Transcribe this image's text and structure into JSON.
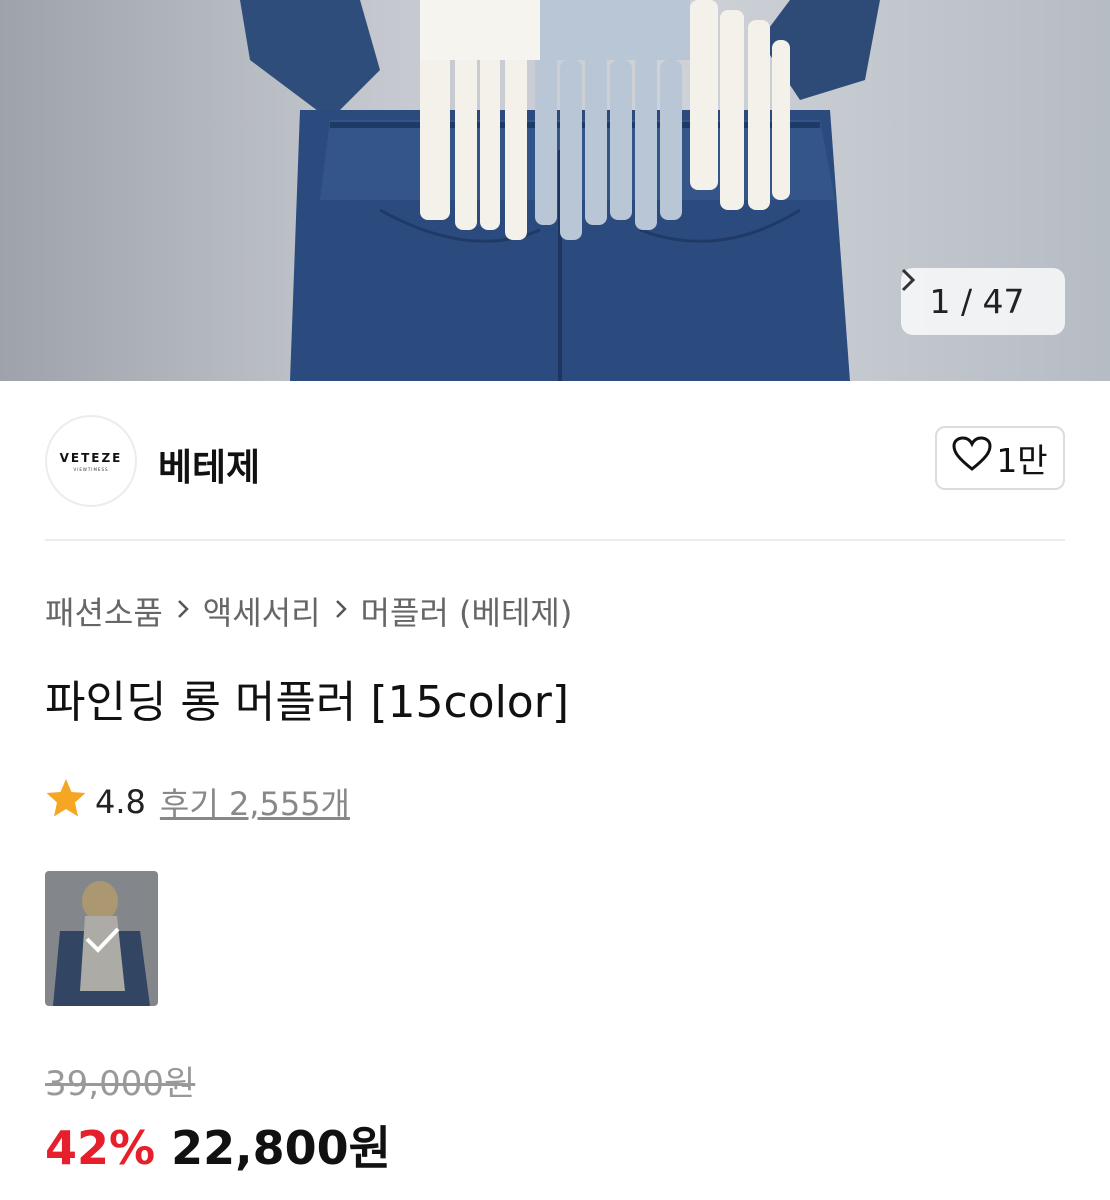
{
  "gallery": {
    "counter": "1 / 47",
    "next_icon": "chevron-right-icon"
  },
  "seller": {
    "logo_text": "VETEZE",
    "logo_subtext": "VIEWTIMESS",
    "name": "베테제",
    "like_count": "1만",
    "like_icon": "heart-outline-icon"
  },
  "breadcrumb": {
    "items": [
      "패션소품",
      "액세서리",
      "머플러 (베테제)"
    ],
    "separator_icon": "chevron-right-icon"
  },
  "product": {
    "title": "파인딩 롱 머플러 [15color]",
    "rating": "4.8",
    "reviews_label": "후기 2,555개",
    "original_price": "39,000원",
    "discount": "42%",
    "price": "22,800원"
  },
  "colors": {
    "discount": "#e51f2b",
    "star": "#f5a623"
  }
}
